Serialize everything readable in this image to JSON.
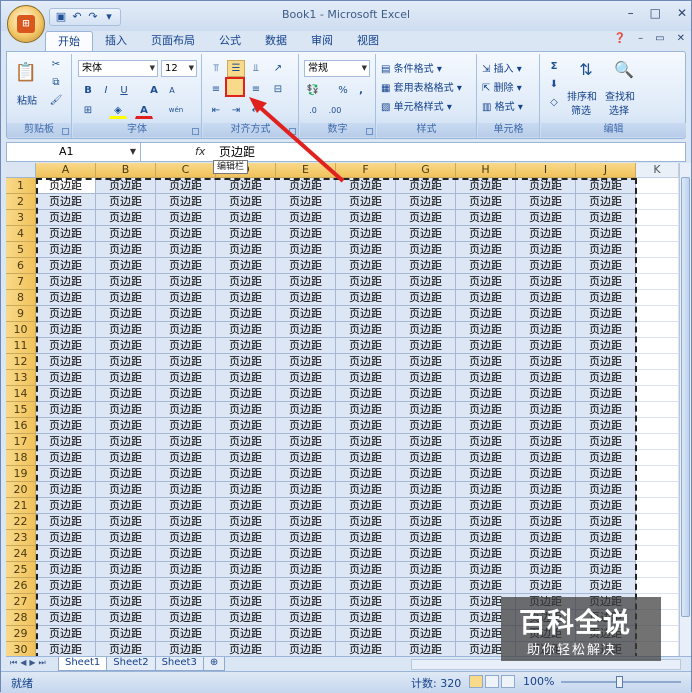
{
  "window": {
    "title": "Book1 - Microsoft Excel",
    "min": "–",
    "max": "□",
    "close": "✕"
  },
  "qat": [
    "save-icon",
    "undo-icon",
    "redo-icon",
    "customize-icon"
  ],
  "tabs": [
    "开始",
    "插入",
    "页面布局",
    "公式",
    "数据",
    "审阅",
    "视图"
  ],
  "ribbon": {
    "clipboard": {
      "label": "剪贴板",
      "paste": "粘贴"
    },
    "font": {
      "label": "字体",
      "name": "宋体",
      "size": "12",
      "bold": "B",
      "italic": "I",
      "underline": "U",
      "grow": "A",
      "shrink": "A",
      "font_color": "A",
      "phonetic": "wén"
    },
    "alignment": {
      "label": "对齐方式"
    },
    "number": {
      "label": "数字",
      "format": "常规",
      "percent": "%",
      "comma": ","
    },
    "styles": {
      "label": "样式",
      "conditional": "条件格式",
      "table": "套用表格格式",
      "cell": "单元格样式"
    },
    "cells": {
      "label": "单元格",
      "insert": "插入",
      "delete": "删除",
      "format": "格式"
    },
    "editing": {
      "label": "编辑",
      "sort": "排序和",
      "filter": "筛选",
      "find": "查找和",
      "select": "选择"
    }
  },
  "formula_bar": {
    "name_box": "A1",
    "fx": "fx",
    "content": "页边距",
    "tooltip": "编辑栏"
  },
  "columns": [
    "A",
    "B",
    "C",
    "D",
    "E",
    "F",
    "G",
    "H",
    "I",
    "J",
    "K"
  ],
  "rows": [
    1,
    2,
    3,
    4,
    5,
    6,
    7,
    8,
    9,
    10,
    11,
    12,
    13,
    14,
    15,
    16,
    17,
    18,
    19,
    20,
    21,
    22,
    23,
    24,
    25,
    26,
    27,
    28,
    29,
    30
  ],
  "cell_text": "页边距",
  "sheets": [
    "Sheet1",
    "Sheet2",
    "Sheet3"
  ],
  "status": {
    "ready": "就绪",
    "count": "计数: 320",
    "zoom": "100%"
  },
  "watermark": {
    "logo": "百科全说",
    "sub": "助你轻松解决"
  },
  "colors": {
    "highlight": "#e0221e",
    "header": "#f1c25a",
    "selection": "#dde6f5"
  }
}
